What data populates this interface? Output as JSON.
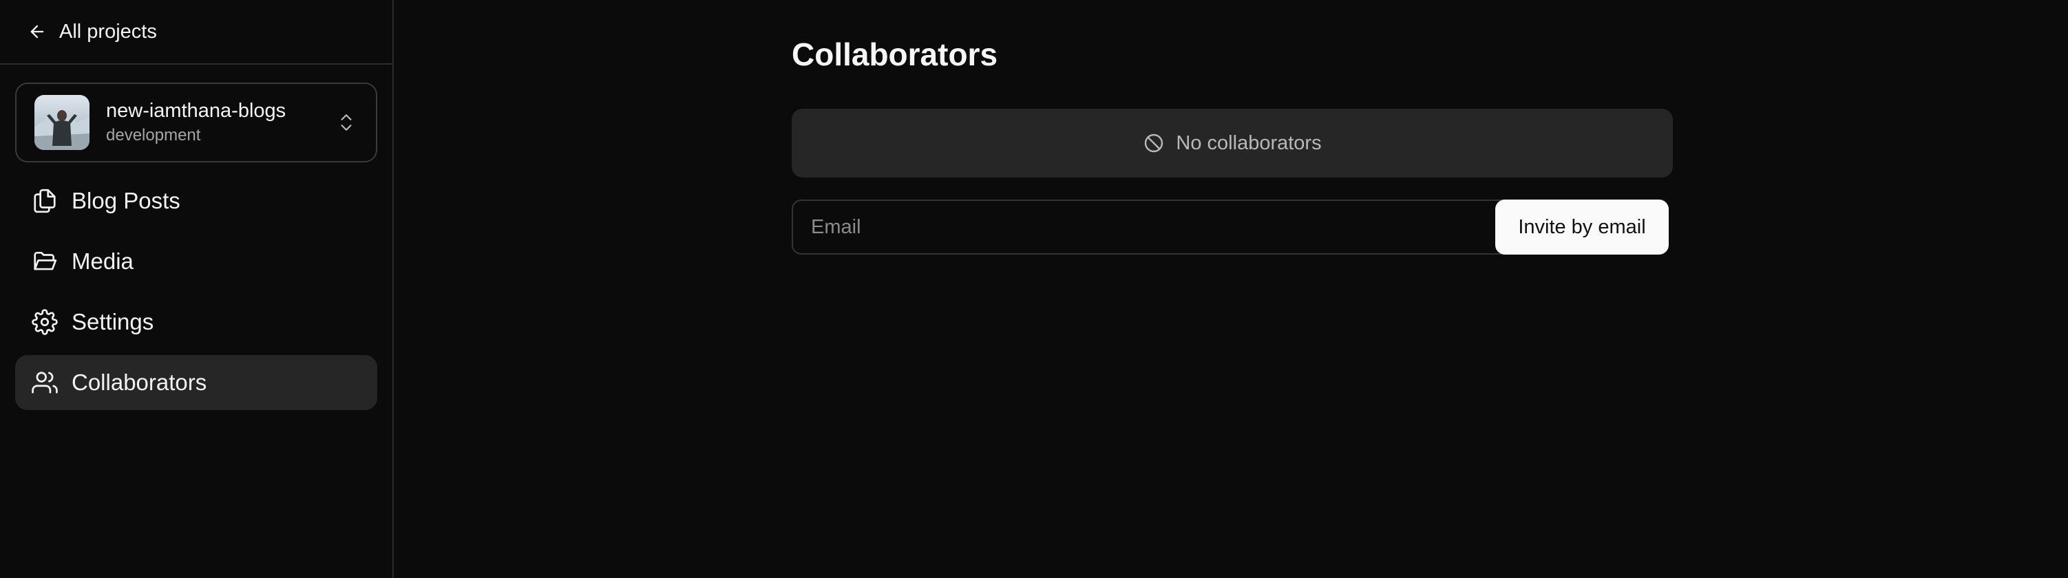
{
  "sidebar": {
    "back_label": "All projects",
    "project": {
      "name": "new-iamthana-blogs",
      "environment": "development"
    },
    "items": [
      {
        "label": "Blog Posts",
        "icon": "documents-icon",
        "active": false
      },
      {
        "label": "Media",
        "icon": "folder-icon",
        "active": false
      },
      {
        "label": "Settings",
        "icon": "gear-icon",
        "active": false
      },
      {
        "label": "Collaborators",
        "icon": "users-icon",
        "active": true
      }
    ]
  },
  "main": {
    "title": "Collaborators",
    "empty_state": "No collaborators",
    "email_placeholder": "Email",
    "email_value": "",
    "invite_label": "Invite by email"
  },
  "colors": {
    "background": "#0b0b0b",
    "panel": "#262626",
    "border": "#2b2b2b",
    "button_bg": "#fafafa"
  }
}
